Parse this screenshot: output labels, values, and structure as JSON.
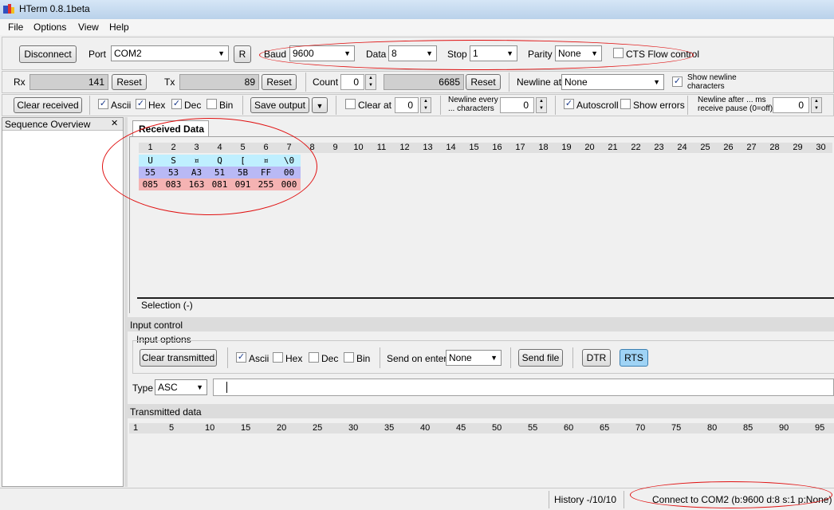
{
  "window": {
    "title": "HTerm 0.8.1beta"
  },
  "menu": [
    "File",
    "Options",
    "View",
    "Help"
  ],
  "conn": {
    "disconnect": "Disconnect",
    "port_label": "Port",
    "port": "COM2",
    "r": "R",
    "baud_label": "Baud",
    "baud": "9600",
    "data_label": "Data",
    "data": "8",
    "stop_label": "Stop",
    "stop": "1",
    "parity_label": "Parity",
    "parity": "None",
    "cts": "CTS Flow control"
  },
  "counters": {
    "rx_label": "Rx",
    "rx": "141",
    "reset": "Reset",
    "tx_label": "Tx",
    "tx": "89",
    "count_label": "Count",
    "count_input": "0",
    "count": "6685",
    "newline_at_label": "Newline at",
    "newline_at": "None",
    "show_newline": "Show newline",
    "show_newline2": "characters"
  },
  "display": {
    "clear_received": "Clear received",
    "ascii": "Ascii",
    "hex": "Hex",
    "dec": "Dec",
    "bin": "Bin",
    "save_output": "Save output",
    "clear_at": "Clear at",
    "clear_at_val": "0",
    "newline_every": "Newline every",
    "newline_every2": "... characters",
    "newline_every_val": "0",
    "autoscroll": "Autoscroll",
    "show_errors": "Show errors",
    "newline_after": "Newline after ... ms",
    "newline_after2": "receive pause (0=off)",
    "newline_after_val": "0"
  },
  "sequence": {
    "title": "Sequence Overview",
    "close": "✕"
  },
  "received": {
    "tab": "Received Data",
    "columns": [
      "1",
      "2",
      "3",
      "4",
      "5",
      "6",
      "7",
      "8",
      "9",
      "10",
      "11",
      "12",
      "13",
      "14",
      "15",
      "16",
      "17",
      "18",
      "19",
      "20",
      "21",
      "22",
      "23",
      "24",
      "25",
      "26",
      "27",
      "28",
      "29",
      "30"
    ],
    "ascii_row": [
      "U",
      "S",
      "¤",
      "Q",
      "[",
      "¤",
      "\\0"
    ],
    "hex_row": [
      "55",
      "53",
      "A3",
      "51",
      "5B",
      "FF",
      "00"
    ],
    "dec_row": [
      "085",
      "083",
      "163",
      "081",
      "091",
      "255",
      "000"
    ],
    "selection": "Selection (-)"
  },
  "input": {
    "title": "Input control",
    "options": "Input options",
    "clear_transmitted": "Clear transmitted",
    "ascii": "Ascii",
    "hex": "Hex",
    "dec": "Dec",
    "bin": "Bin",
    "send_on_enter_label": "Send on enter",
    "send_on_enter": "None",
    "send_file": "Send file",
    "dtr": "DTR",
    "rts": "RTS",
    "type_label": "Type",
    "type": "ASC"
  },
  "transmitted": {
    "title": "Transmitted data",
    "columns": [
      "1",
      "5",
      "10",
      "15",
      "20",
      "25",
      "30",
      "35",
      "40",
      "45",
      "50",
      "55",
      "60",
      "65",
      "70",
      "75",
      "80",
      "85",
      "90",
      "95"
    ]
  },
  "status": {
    "history": "History -/10/10",
    "connection": "Connect to COM2 (b:9600 d:8 s:1 p:None)"
  },
  "colors": {
    "ascii_bg": "#bfefff",
    "hex_bg": "#b9b9f5",
    "dec_bg": "#f5b3b3",
    "rts_active": "#9fd3f5",
    "annotation": "#e01010"
  }
}
